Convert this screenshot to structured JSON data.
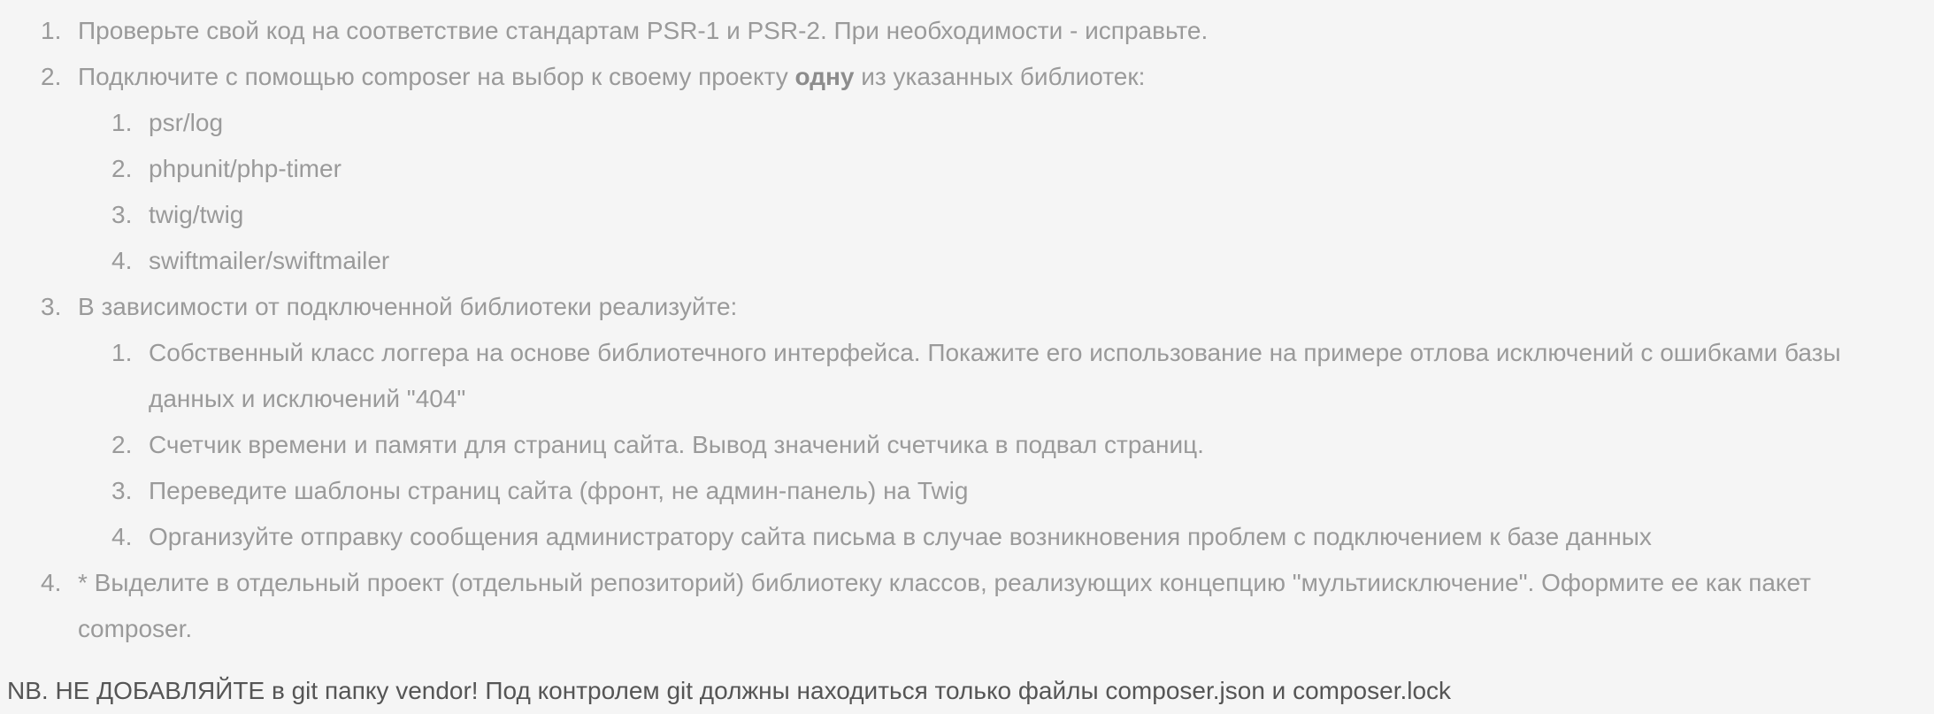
{
  "list": {
    "item1": {
      "num": "1.",
      "text": "Проверьте свой код на соответствие стандартам PSR-1 и PSR-2. При необходимости - исправьте."
    },
    "item2": {
      "num": "2.",
      "text_before": "Подключите с помощью composer на выбор к своему проекту ",
      "text_bold": "одну",
      "text_after": " из указанных библиотек:",
      "sub": [
        {
          "num": "1.",
          "text": "psr/log"
        },
        {
          "num": "2.",
          "text": "phpunit/php-timer"
        },
        {
          "num": "3.",
          "text": "twig/twig"
        },
        {
          "num": "4.",
          "text": "swiftmailer/swiftmailer"
        }
      ]
    },
    "item3": {
      "num": "3.",
      "text": "В зависимости от подключенной библиотеки реализуйте:",
      "sub": [
        {
          "num": "1.",
          "text": "Собственный класс логгера на основе библиотечного интерфейса. Покажите его использование на примере отлова исключений с ошибками базы данных и исключений \"404\""
        },
        {
          "num": "2.",
          "text": "Счетчик времени и памяти для страниц сайта. Вывод значений счетчика в подвал страниц."
        },
        {
          "num": "3.",
          "text": "Переведите шаблоны страниц сайта (фронт, не админ-панель) на Twig"
        },
        {
          "num": "4.",
          "text": "Организуйте отправку сообщения администратору сайта письма в случае возникновения проблем с подключением к базе данных"
        }
      ]
    },
    "item4": {
      "num": "4.",
      "text": "* Выделите в отдельный проект (отдельный репозиторий) библиотеку классов, реализующих концепцию \"мультиисключение\". Оформите ее как пакет composer."
    }
  },
  "note": "NB. НЕ ДОБАВЛЯЙТЕ в git папку vendor! Под контролем git должны находиться только файлы composer.json и composer.lock"
}
